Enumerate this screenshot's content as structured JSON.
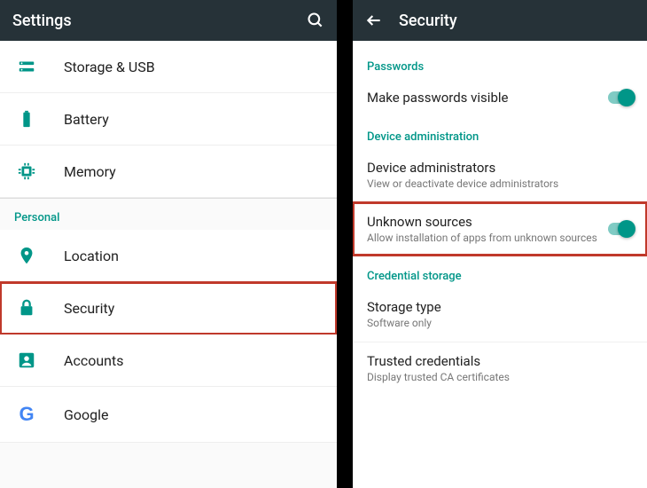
{
  "colors": {
    "accent": "#009688",
    "appbar": "#263238",
    "highlight": "#c0392b"
  },
  "left": {
    "title": "Settings",
    "items": [
      {
        "icon": "storage-icon",
        "label": "Storage & USB"
      },
      {
        "icon": "battery-icon",
        "label": "Battery"
      },
      {
        "icon": "memory-icon",
        "label": "Memory"
      }
    ],
    "personal": {
      "header": "Personal",
      "items": [
        {
          "icon": "location-icon",
          "label": "Location"
        },
        {
          "icon": "lock-icon",
          "label": "Security",
          "highlighted": true
        },
        {
          "icon": "account-icon",
          "label": "Accounts"
        },
        {
          "icon": "google-icon",
          "label": "Google"
        }
      ]
    }
  },
  "right": {
    "title": "Security",
    "sections": [
      {
        "header": "Passwords",
        "items": [
          {
            "primary": "Make passwords visible",
            "toggle": true
          }
        ]
      },
      {
        "header": "Device administration",
        "items": [
          {
            "primary": "Device administrators",
            "secondary": "View or deactivate device administrators"
          },
          {
            "primary": "Unknown sources",
            "secondary": "Allow installation of apps from unknown sources",
            "toggle": true,
            "highlighted": true
          }
        ]
      },
      {
        "header": "Credential storage",
        "items": [
          {
            "primary": "Storage type",
            "secondary": "Software only"
          },
          {
            "primary": "Trusted credentials",
            "secondary": "Display trusted CA certificates"
          }
        ]
      }
    ]
  }
}
